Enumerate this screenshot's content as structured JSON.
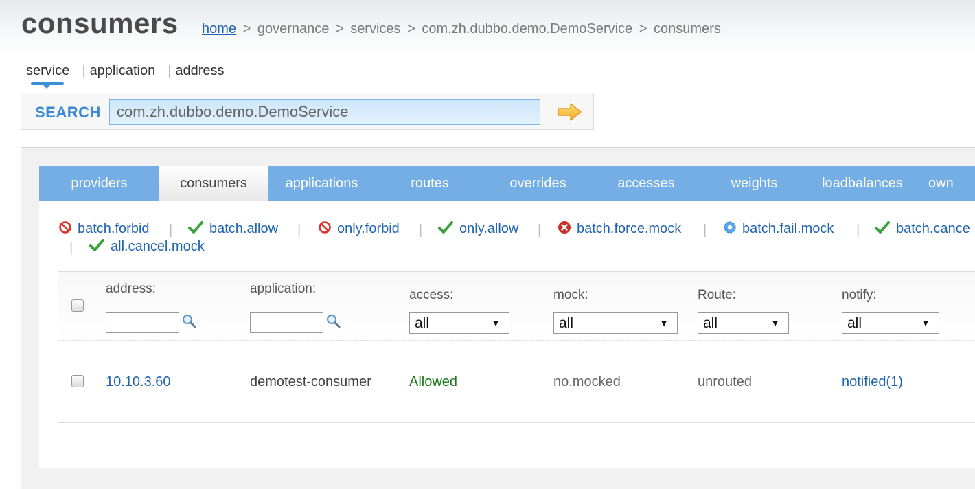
{
  "page": {
    "title": "consumers"
  },
  "breadcrumb": {
    "home": "home",
    "items": [
      "governance",
      "services",
      "com.zh.dubbo.demo.DemoService",
      "consumers"
    ],
    "separator": ">"
  },
  "search": {
    "tabs": [
      "service",
      "application",
      "address"
    ],
    "tab_separator": "|",
    "active_tab": "service",
    "label": "SEARCH",
    "value": "com.zh.dubbo.demo.DemoService"
  },
  "nav": {
    "tabs": [
      "providers",
      "consumers",
      "applications",
      "routes",
      "overrides",
      "accesses",
      "weights",
      "loadbalances",
      "own"
    ],
    "active": "consumers"
  },
  "ops": {
    "items": [
      {
        "label": "batch.forbid",
        "icon": "forbid-icon"
      },
      {
        "label": "batch.allow",
        "icon": "check-icon"
      },
      {
        "label": "only.forbid",
        "icon": "forbid-icon"
      },
      {
        "label": "only.allow",
        "icon": "check-icon"
      },
      {
        "label": "batch.force.mock",
        "icon": "error-icon"
      },
      {
        "label": "batch.fail.mock",
        "icon": "gear-icon"
      },
      {
        "label": "batch.cance",
        "icon": "check-icon"
      },
      {
        "label": "all.cancel.mock",
        "icon": "check-icon"
      }
    ],
    "separator": "|"
  },
  "table": {
    "columns": {
      "address": "address:",
      "application": "application:",
      "access": "access:",
      "mock": "mock:",
      "route": "Route:",
      "notify": "notify:"
    },
    "filters": {
      "access": "all",
      "mock": "all",
      "route": "all",
      "notify": "all"
    },
    "rows": [
      {
        "address": "10.10.3.60",
        "application": "demotest-consumer",
        "access": "Allowed",
        "mock": "no.mocked",
        "route": "unrouted",
        "notify": "notified(1)"
      }
    ]
  },
  "colors": {
    "nav_bg": "#74aee4",
    "link": "#1f64b0",
    "search_label": "#3d8ad4",
    "allowed": "#1a7a1a",
    "forbid": "#d9342b",
    "check": "#3aa13a"
  }
}
